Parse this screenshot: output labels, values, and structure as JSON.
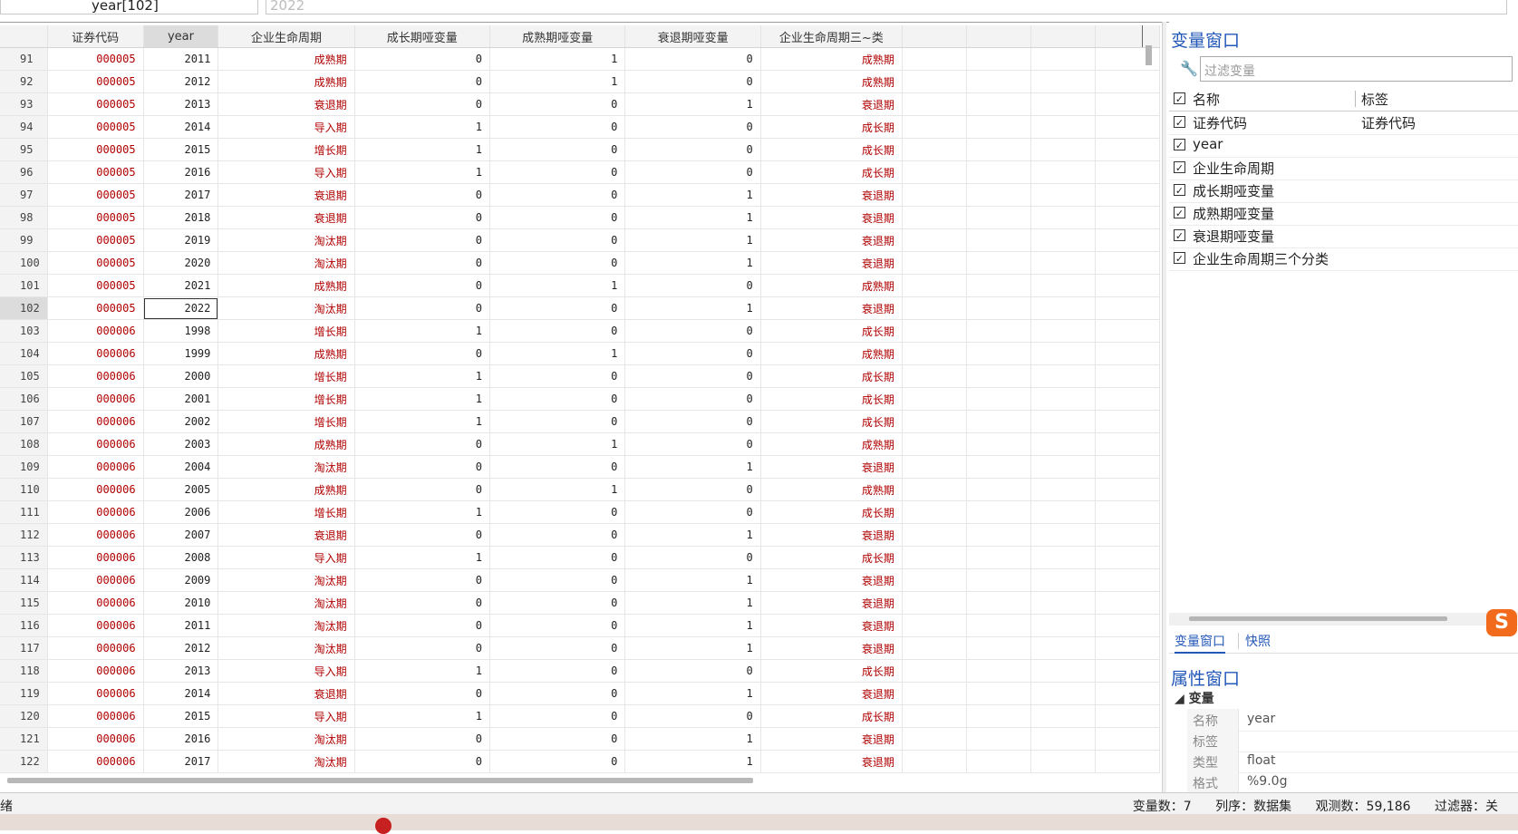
{
  "formula_bar": {
    "cell_ref": "year[102]",
    "cell_value": "2022"
  },
  "grid": {
    "headers": [
      "证券代码",
      "year",
      "企业生命周期",
      "成长期哑变量",
      "成熟期哑变量",
      "衰退期哑变量",
      "企业生命周期三~类"
    ],
    "selected_row": 102,
    "rows": [
      [
        "91",
        "000005",
        "2011",
        "成熟期",
        "0",
        "1",
        "0",
        "成熟期"
      ],
      [
        "92",
        "000005",
        "2012",
        "成熟期",
        "0",
        "1",
        "0",
        "成熟期"
      ],
      [
        "93",
        "000005",
        "2013",
        "衰退期",
        "0",
        "0",
        "1",
        "衰退期"
      ],
      [
        "94",
        "000005",
        "2014",
        "导入期",
        "1",
        "0",
        "0",
        "成长期"
      ],
      [
        "95",
        "000005",
        "2015",
        "增长期",
        "1",
        "0",
        "0",
        "成长期"
      ],
      [
        "96",
        "000005",
        "2016",
        "导入期",
        "1",
        "0",
        "0",
        "成长期"
      ],
      [
        "97",
        "000005",
        "2017",
        "衰退期",
        "0",
        "0",
        "1",
        "衰退期"
      ],
      [
        "98",
        "000005",
        "2018",
        "衰退期",
        "0",
        "0",
        "1",
        "衰退期"
      ],
      [
        "99",
        "000005",
        "2019",
        "淘汰期",
        "0",
        "0",
        "1",
        "衰退期"
      ],
      [
        "100",
        "000005",
        "2020",
        "淘汰期",
        "0",
        "0",
        "1",
        "衰退期"
      ],
      [
        "101",
        "000005",
        "2021",
        "成熟期",
        "0",
        "1",
        "0",
        "成熟期"
      ],
      [
        "102",
        "000005",
        "2022",
        "淘汰期",
        "0",
        "0",
        "1",
        "衰退期"
      ],
      [
        "103",
        "000006",
        "1998",
        "增长期",
        "1",
        "0",
        "0",
        "成长期"
      ],
      [
        "104",
        "000006",
        "1999",
        "成熟期",
        "0",
        "1",
        "0",
        "成熟期"
      ],
      [
        "105",
        "000006",
        "2000",
        "增长期",
        "1",
        "0",
        "0",
        "成长期"
      ],
      [
        "106",
        "000006",
        "2001",
        "增长期",
        "1",
        "0",
        "0",
        "成长期"
      ],
      [
        "107",
        "000006",
        "2002",
        "增长期",
        "1",
        "0",
        "0",
        "成长期"
      ],
      [
        "108",
        "000006",
        "2003",
        "成熟期",
        "0",
        "1",
        "0",
        "成熟期"
      ],
      [
        "109",
        "000006",
        "2004",
        "淘汰期",
        "0",
        "0",
        "1",
        "衰退期"
      ],
      [
        "110",
        "000006",
        "2005",
        "成熟期",
        "0",
        "1",
        "0",
        "成熟期"
      ],
      [
        "111",
        "000006",
        "2006",
        "增长期",
        "1",
        "0",
        "0",
        "成长期"
      ],
      [
        "112",
        "000006",
        "2007",
        "衰退期",
        "0",
        "0",
        "1",
        "衰退期"
      ],
      [
        "113",
        "000006",
        "2008",
        "导入期",
        "1",
        "0",
        "0",
        "成长期"
      ],
      [
        "114",
        "000006",
        "2009",
        "淘汰期",
        "0",
        "0",
        "1",
        "衰退期"
      ],
      [
        "115",
        "000006",
        "2010",
        "淘汰期",
        "0",
        "0",
        "1",
        "衰退期"
      ],
      [
        "116",
        "000006",
        "2011",
        "淘汰期",
        "0",
        "0",
        "1",
        "衰退期"
      ],
      [
        "117",
        "000006",
        "2012",
        "淘汰期",
        "0",
        "0",
        "1",
        "衰退期"
      ],
      [
        "118",
        "000006",
        "2013",
        "导入期",
        "1",
        "0",
        "0",
        "成长期"
      ],
      [
        "119",
        "000006",
        "2014",
        "衰退期",
        "0",
        "0",
        "1",
        "衰退期"
      ],
      [
        "120",
        "000006",
        "2015",
        "导入期",
        "1",
        "0",
        "0",
        "成长期"
      ],
      [
        "121",
        "000006",
        "2016",
        "淘汰期",
        "0",
        "0",
        "1",
        "衰退期"
      ],
      [
        "122",
        "000006",
        "2017",
        "淘汰期",
        "0",
        "0",
        "1",
        "衰退期"
      ]
    ]
  },
  "variables_window": {
    "title": "变量窗口",
    "filter_placeholder": "过滤变量",
    "col_name": "名称",
    "col_label": "标签",
    "variables": [
      {
        "name": "证券代码",
        "label": "证券代码"
      },
      {
        "name": "year",
        "label": ""
      },
      {
        "name": "企业生命周期",
        "label": ""
      },
      {
        "name": "成长期哑变量",
        "label": ""
      },
      {
        "name": "成熟期哑变量",
        "label": ""
      },
      {
        "name": "衰退期哑变量",
        "label": ""
      },
      {
        "name": "企业生命周期三个分类",
        "label": ""
      }
    ]
  },
  "tabs": {
    "variables": "变量窗口",
    "snapshots": "快照"
  },
  "properties_window": {
    "title": "属性窗口",
    "section": "变量",
    "props": [
      {
        "k": "名称",
        "v": "year"
      },
      {
        "k": "标签",
        "v": ""
      },
      {
        "k": "类型",
        "v": "float"
      },
      {
        "k": "格式",
        "v": "%9.0g"
      }
    ]
  },
  "status": {
    "left": "绪",
    "vars": "变量数：7",
    "order": "列序：数据集",
    "obs": "观测数：59,186",
    "filter": "过滤器：关"
  },
  "colors": {
    "accent": "#2458b8",
    "string_value": "#b00000",
    "sogou": "#f26b1d"
  },
  "icons": {
    "filter": "wrench-icon",
    "check": "checkbox-icon",
    "ime": "sogou-icon"
  }
}
